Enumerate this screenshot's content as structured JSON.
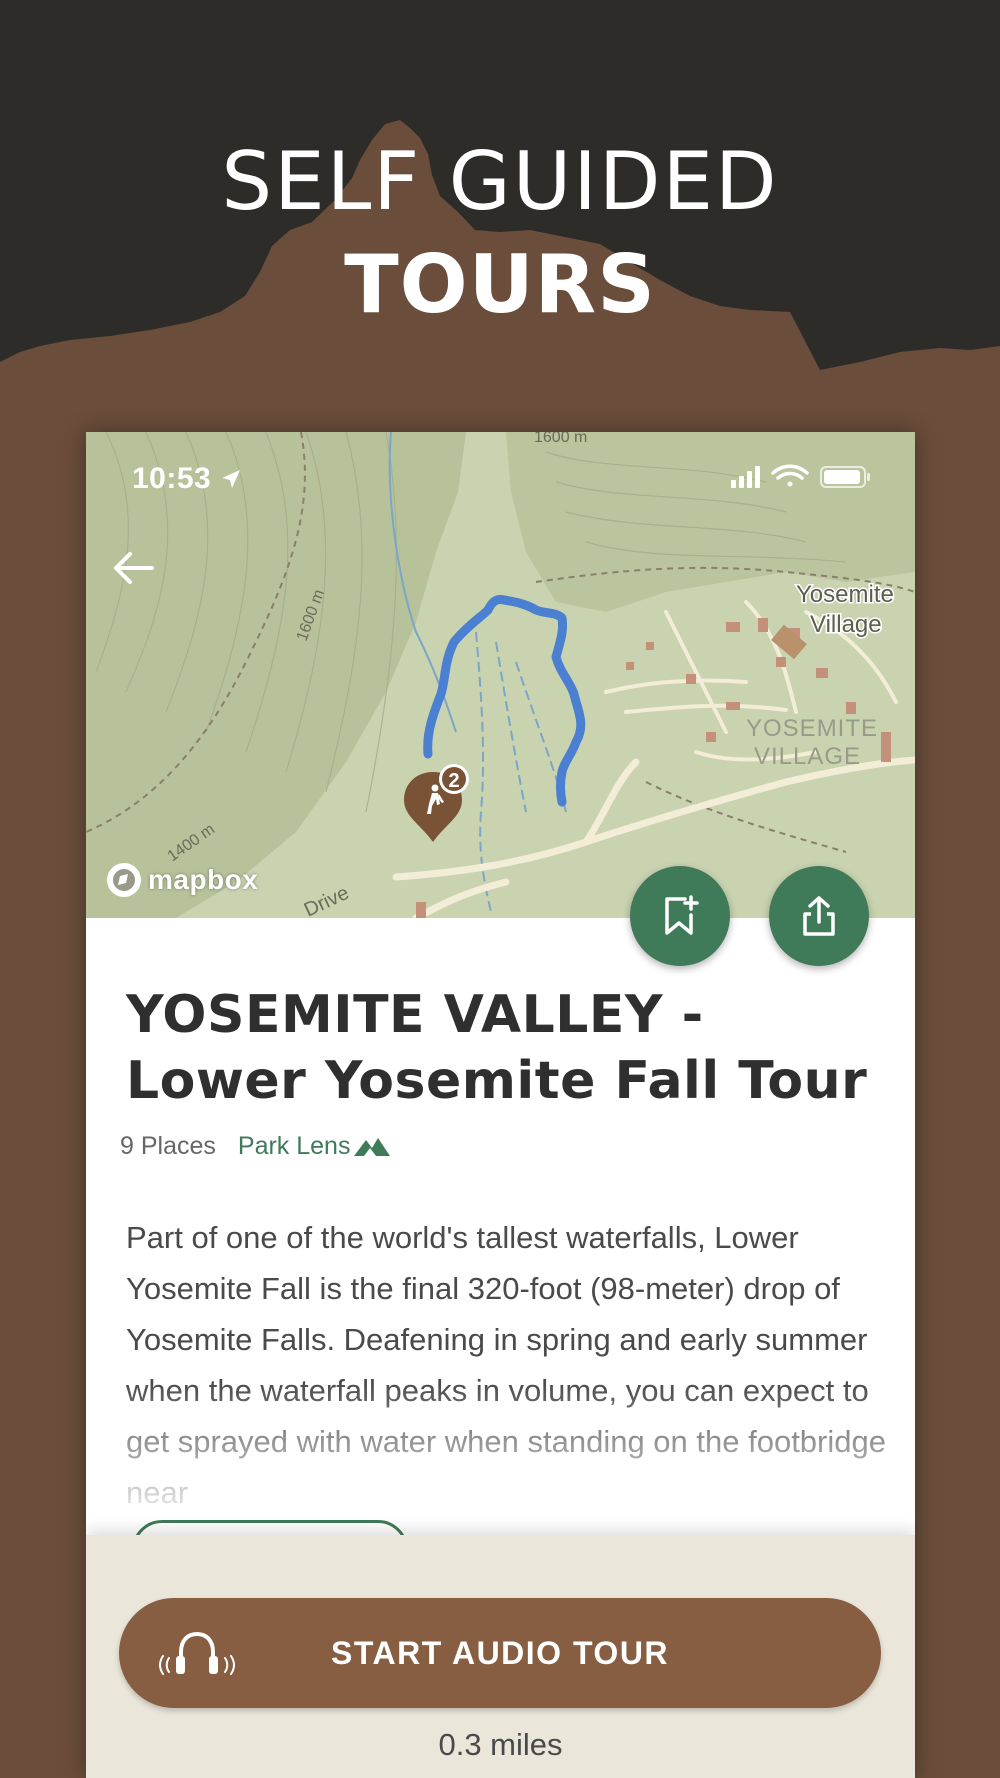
{
  "promo": {
    "line1": "SELF GUIDED",
    "line2": "TOURS"
  },
  "status_bar": {
    "time": "10:53",
    "icons": [
      "location-arrow-icon",
      "signal-icon",
      "wifi-icon",
      "battery-icon"
    ]
  },
  "map": {
    "labels": {
      "elevation_top": "1600 m",
      "elevation_left": "1600 m",
      "elevation_bottom": "1400 m",
      "village_1": "Yosemite",
      "village_2": "Village",
      "village_caps_1": "YOSEMITE",
      "village_caps_2": "VILLAGE",
      "drive": "Drive"
    },
    "marker_badge": "2",
    "attribution": "mapbox"
  },
  "tour": {
    "title_line1": "YOSEMITE VALLEY -",
    "title_line2": "Lower Yosemite Fall Tour",
    "places": "9 Places",
    "lens": "Park Lens",
    "description": "Part of one of the world's tallest waterfalls, Lower Yosemite Fall is the final 320-foot (98-meter) drop of Yosemite Falls. Deafening in spring and early summer when the waterfall peaks in volume, you can expect to get sprayed with water when standing on the footbridge near"
  },
  "actions": {
    "audio_label": "START AUDIO TOUR",
    "distance": "0.3 miles"
  },
  "colors": {
    "background_brown": "#6a4d3a",
    "header_dark": "#2d2c29",
    "accent_green": "#3f7a59",
    "button_brown": "#875e41",
    "panel_cream": "#ebe6da",
    "route_blue": "#4a7fd1"
  }
}
